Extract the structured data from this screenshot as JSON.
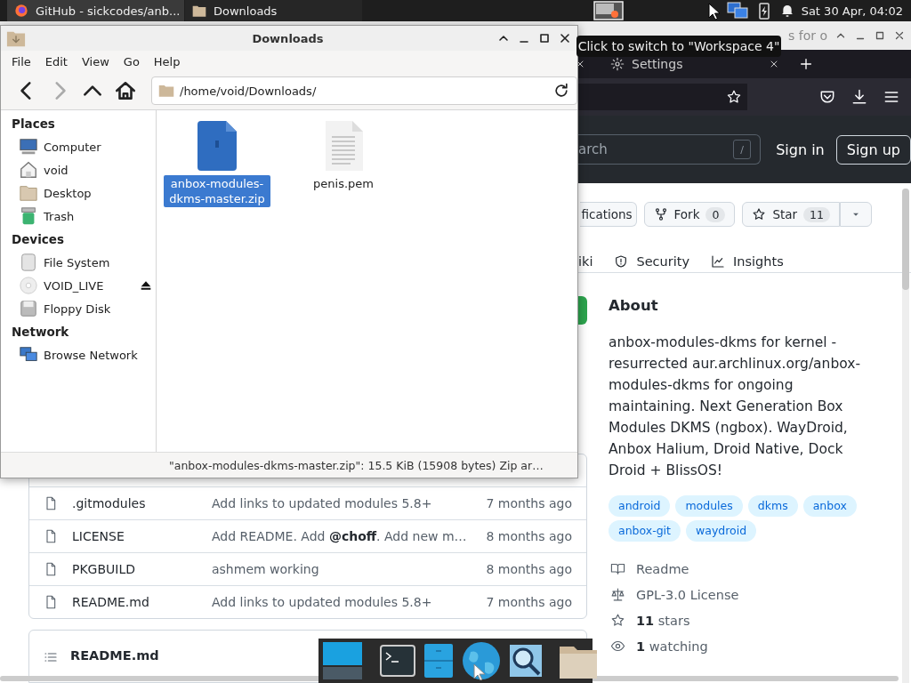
{
  "top_panel": {
    "tasks": [
      {
        "label": "GitHub - sickcodes/anb...",
        "kind": "browser",
        "selected": false
      },
      {
        "label": "Downloads",
        "kind": "files",
        "selected": true
      }
    ],
    "clock": "Sat 30 Apr, 04:02"
  },
  "tooltip": "Click to switch to \"Workspace 4\"",
  "browser": {
    "title": "s for o",
    "tabs": [
      {
        "label": "Settings"
      }
    ],
    "search": {
      "placeholder": "arch",
      "key": "/"
    },
    "sign_in": "Sign in",
    "sign_up": "Sign up",
    "actions": [
      {
        "kind": "plain",
        "label": "fications"
      },
      {
        "kind": "fork",
        "label": "Fork",
        "count": "0"
      },
      {
        "kind": "star",
        "label": "Star",
        "count": "11"
      }
    ],
    "nav": [
      {
        "kind": "plain",
        "label": "iki"
      },
      {
        "kind": "shield",
        "label": "Security"
      },
      {
        "kind": "graph",
        "label": "Insights"
      }
    ],
    "files": [
      {
        "name": ".gitmodules",
        "message": "Add links to updated modules 5.8+",
        "age": "7 months ago"
      },
      {
        "name": "LICENSE",
        "message": "Add README. Add **@choff**. Add new m…",
        "age": "8 months ago"
      },
      {
        "name": "PKGBUILD",
        "message": "ashmem working",
        "age": "8 months ago"
      },
      {
        "name": "README.md",
        "message": "Add links to updated modules 5.8+",
        "age": "7 months ago"
      }
    ],
    "readme_title": "README.md",
    "about": {
      "heading": "About",
      "description": "anbox-modules-dkms for kernel - resurrected aur.archlinux.org/anbox-modules-dkms for ongoing maintaining. Next Generation Box Modules DKMS (ngbox). WayDroid, Anbox Halium, Droid Native, Dock Droid + BlissOS!",
      "topics": [
        "android",
        "modules",
        "dkms",
        "anbox",
        "anbox-git",
        "waydroid"
      ],
      "links": [
        {
          "kind": "book",
          "text": "Readme"
        },
        {
          "kind": "scale",
          "text": "GPL-3.0 License"
        },
        {
          "kind": "star",
          "text": "**11** stars"
        },
        {
          "kind": "eye",
          "text": "**1** watching"
        }
      ]
    }
  },
  "file_manager": {
    "title": "Downloads",
    "menu": [
      "File",
      "Edit",
      "View",
      "Go",
      "Help"
    ],
    "nav_buttons": [
      {
        "kind": "back",
        "disabled": false
      },
      {
        "kind": "forward",
        "disabled": true
      },
      {
        "kind": "up",
        "disabled": false
      },
      {
        "kind": "home",
        "disabled": false
      }
    ],
    "path": "/home/void/Downloads/",
    "sidebar": [
      {
        "heading": "Places",
        "items": [
          {
            "label": "Computer",
            "kind": "computer"
          },
          {
            "label": "void",
            "kind": "home"
          },
          {
            "label": "Desktop",
            "kind": "desktop"
          },
          {
            "label": "Trash",
            "kind": "trash"
          }
        ]
      },
      {
        "heading": "Devices",
        "items": [
          {
            "label": "File System",
            "kind": "drive"
          },
          {
            "label": "VOID_LIVE",
            "kind": "disc",
            "ejectable": true
          },
          {
            "label": "Floppy Disk",
            "kind": "floppy"
          }
        ]
      },
      {
        "heading": "Network",
        "items": [
          {
            "label": "Browse Network",
            "kind": "network"
          }
        ]
      }
    ],
    "files": [
      {
        "name": "anbox-modules-dkms-master.zip",
        "kind": "zip",
        "selected": true
      },
      {
        "name": "penis.pem",
        "kind": "text",
        "selected": false
      }
    ],
    "status": "\"anbox-modules-dkms-master.zip\": 15.5 KiB (15908 bytes) Zip ar…"
  },
  "dock": [
    {
      "kind": "workspace"
    },
    {
      "kind": "terminal"
    },
    {
      "kind": "cabinet"
    },
    {
      "kind": "globe"
    },
    {
      "kind": "magnifier"
    },
    {
      "kind": "folder"
    }
  ]
}
